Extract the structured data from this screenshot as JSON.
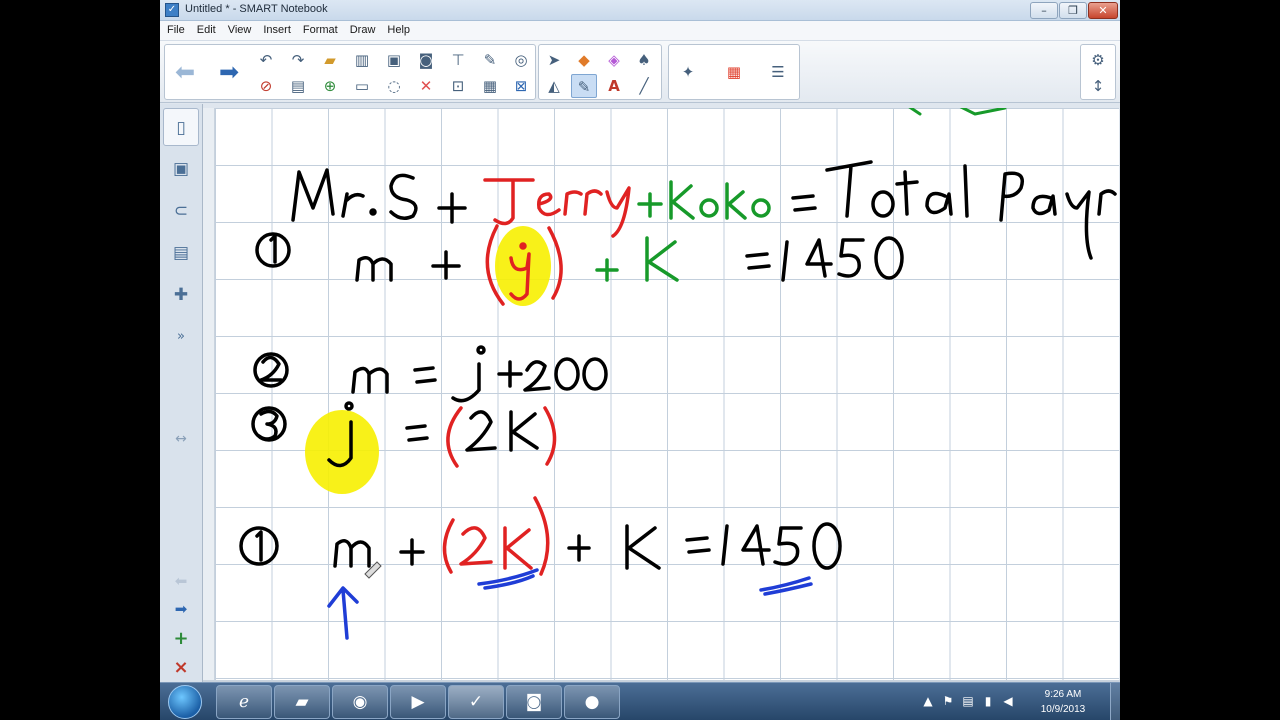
{
  "window": {
    "title": "Untitled * - SMART Notebook",
    "controls": {
      "minimize": "–",
      "maximize": "❐",
      "close": "✕"
    }
  },
  "menu": [
    "File",
    "Edit",
    "View",
    "Insert",
    "Format",
    "Draw",
    "Help"
  ],
  "toolbar": {
    "nav": {
      "back": "⬅",
      "forward": "➡"
    },
    "icons": [
      "undo-icon",
      "redo-icon",
      "open-icon",
      "screen-shade-icon",
      "screen-capture-icon",
      "camera-icon",
      "table-icon",
      "pen-icon",
      "delete-icon",
      "save-icon",
      "add-page-icon",
      "print-icon",
      "paste-icon",
      "cut-icon",
      "fullscreen-icon",
      "grid-icon",
      "close-doc-icon"
    ],
    "tools": [
      "select-icon",
      "shapes-icon",
      "eraser-icon",
      "fill-icon",
      "line-eraser-icon",
      "pens-icon",
      "text-icon",
      "line-icon"
    ],
    "right": [
      "magic-pen-icon",
      "color-palette-icon",
      "properties-icon"
    ],
    "side": {
      "settings": "⚙",
      "move": "↕"
    }
  },
  "sidebar": {
    "tabs": [
      "page-sorter-icon",
      "gallery-icon",
      "attachments-icon",
      "properties-tab-icon",
      "addons-icon"
    ],
    "expand": "»",
    "resize": "↔",
    "page_back": "⬅",
    "page_forward": "➡",
    "add_page": "+",
    "delete_page": "×"
  },
  "colors": {
    "black_ink": "#000000",
    "red_ink": "#e02222",
    "green_ink": "#179a2a",
    "blue_ink": "#1f3dd6",
    "highlight": "#f7f000",
    "grid": "#c3cfdc"
  },
  "taskbar": {
    "apps": [
      "internet-explorer-icon",
      "file-explorer-icon",
      "chrome-icon",
      "media-player-icon",
      "smart-notebook-icon",
      "document-camera-icon",
      "recorder-icon"
    ],
    "tray": [
      "show-hidden-icon",
      "flag-icon",
      "network-icon",
      "signal-icon",
      "volume-icon"
    ],
    "time": "9:26 AM",
    "date": "10/9/2013"
  }
}
